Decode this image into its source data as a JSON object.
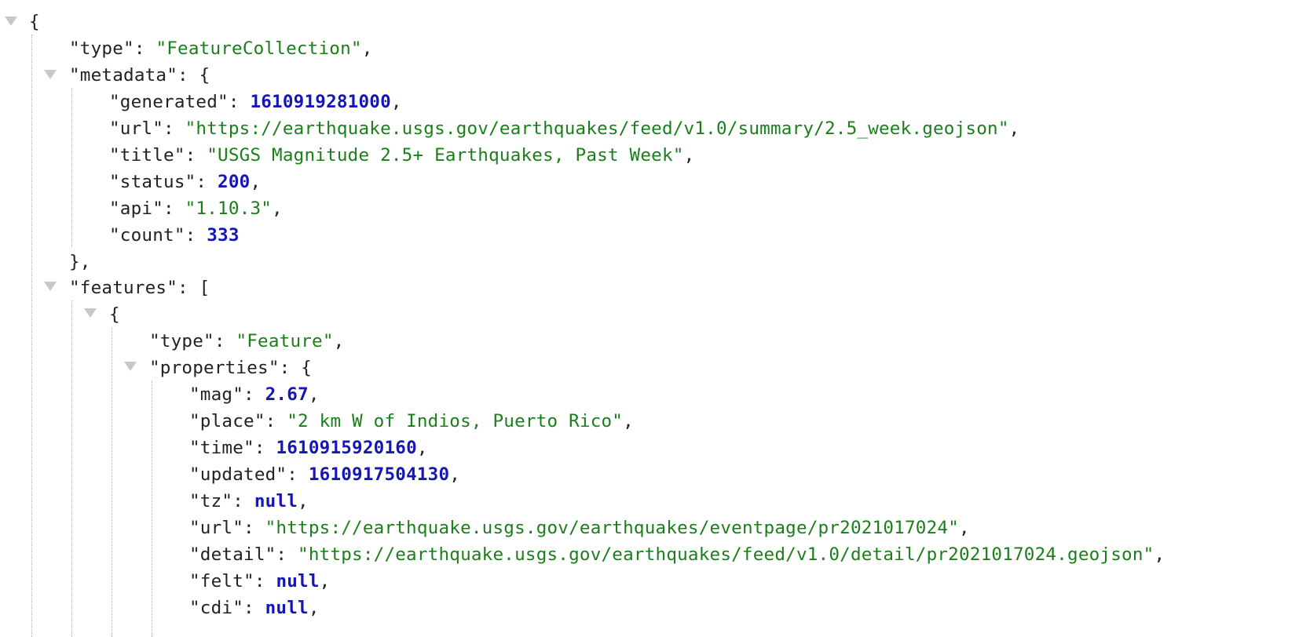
{
  "syntax": {
    "open_brace": "{",
    "close_brace": "}",
    "close_brace_comma": "},",
    "open_bracket": "[",
    "colon": ": ",
    "comma": ","
  },
  "root": {
    "type_key": "\"type\"",
    "type_value": "\"FeatureCollection\"",
    "metadata_key": "\"metadata\"",
    "features_key": "\"features\""
  },
  "metadata": {
    "generated": {
      "key": "\"generated\"",
      "value": "1610919281000"
    },
    "url": {
      "key": "\"url\"",
      "value": "\"https://earthquake.usgs.gov/earthquakes/feed/v1.0/summary/2.5_week.geojson\""
    },
    "title": {
      "key": "\"title\"",
      "value": "\"USGS Magnitude 2.5+ Earthquakes, Past Week\""
    },
    "status": {
      "key": "\"status\"",
      "value": "200"
    },
    "api": {
      "key": "\"api\"",
      "value": "\"1.10.3\""
    },
    "count": {
      "key": "\"count\"",
      "value": "333"
    }
  },
  "feature": {
    "type_key": "\"type\"",
    "type_value": "\"Feature\"",
    "properties_key": "\"properties\"",
    "properties": {
      "mag": {
        "key": "\"mag\"",
        "value": "2.67"
      },
      "place": {
        "key": "\"place\"",
        "value": "\"2 km W of Indios, Puerto Rico\""
      },
      "time": {
        "key": "\"time\"",
        "value": "1610915920160"
      },
      "updated": {
        "key": "\"updated\"",
        "value": "1610917504130"
      },
      "tz": {
        "key": "\"tz\"",
        "value": "null"
      },
      "url": {
        "key": "\"url\"",
        "value": "\"https://earthquake.usgs.gov/earthquakes/eventpage/pr2021017024\""
      },
      "detail": {
        "key": "\"detail\"",
        "value": "\"https://earthquake.usgs.gov/earthquakes/feed/v1.0/detail/pr2021017024.geojson\""
      },
      "felt": {
        "key": "\"felt\"",
        "value": "null"
      },
      "cdi": {
        "key": "\"cdi\"",
        "value": "null"
      }
    }
  },
  "icons": {
    "collapse": "triangle-down"
  },
  "colors": {
    "string": "#1a7f1a",
    "number": "#1515b8",
    "key": "#222222",
    "toggle": "#c8c8c8",
    "guide": "#a8a8a8"
  }
}
